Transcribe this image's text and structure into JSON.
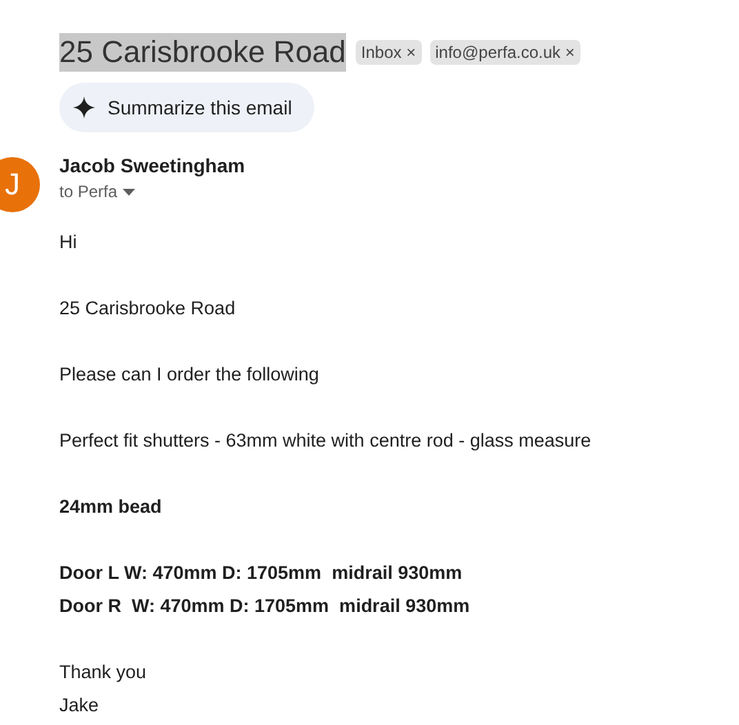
{
  "subject": {
    "text": "25 Carisbrooke Road",
    "selected": true
  },
  "labels": [
    {
      "text": "Inbox",
      "remove": "×"
    },
    {
      "text": "info@perfa.co.uk",
      "remove": "×"
    }
  ],
  "summarize_button": {
    "label": "Summarize this email"
  },
  "sender": {
    "initial": "J",
    "color": "#e8710a",
    "name": "Jacob Sweetingham",
    "recipients": "to Perfa"
  },
  "body": [
    {
      "bold": false,
      "lines": [
        "Hi"
      ]
    },
    {
      "bold": false,
      "lines": [
        "25 Carisbrooke Road"
      ]
    },
    {
      "bold": false,
      "lines": [
        "Please can I order the following"
      ]
    },
    {
      "bold": false,
      "lines": [
        "Perfect fit shutters - 63mm white with centre rod - glass measure"
      ]
    },
    {
      "bold": true,
      "lines": [
        "24mm bead"
      ]
    },
    {
      "bold": true,
      "lines": [
        "Door L W: 470mm D: 1705mm  midrail 930mm",
        "Door R  W: 470mm D: 1705mm  midrail 930mm"
      ]
    },
    {
      "bold": false,
      "lines": [
        "Thank you",
        "Jake"
      ]
    }
  ]
}
